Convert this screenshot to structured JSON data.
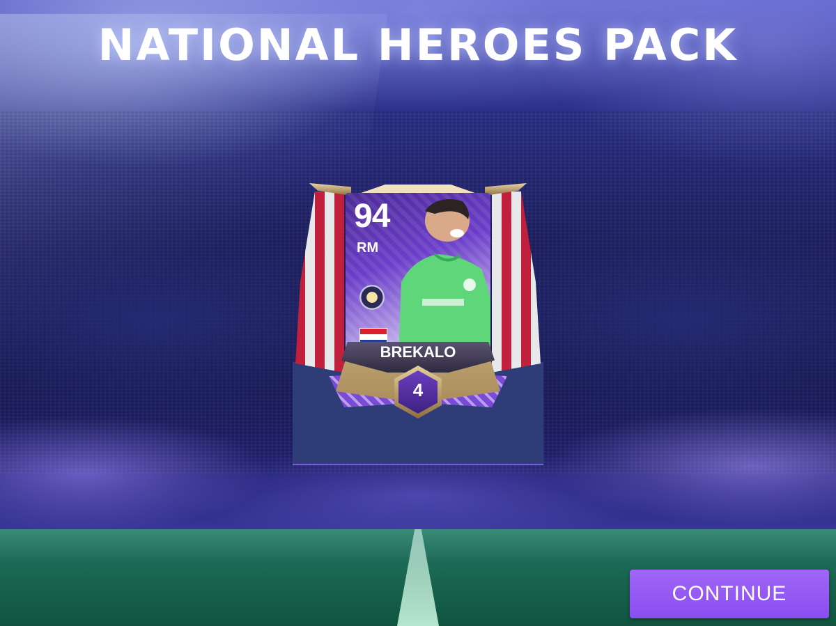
{
  "header": {
    "title": "NATIONAL HEROES PACK"
  },
  "card": {
    "rating": "94",
    "position": "RM",
    "name": "BREKALO",
    "level": "4",
    "nation_flag": "croatia-flag",
    "club_badge": "club-badge-icon",
    "theme_color": "#6b3ec9",
    "jersey_color": "#5fd67a"
  },
  "actions": {
    "continue_label": "CONTINUE"
  },
  "colors": {
    "button": "#9a5cf5",
    "panel": "#2e3d78"
  }
}
